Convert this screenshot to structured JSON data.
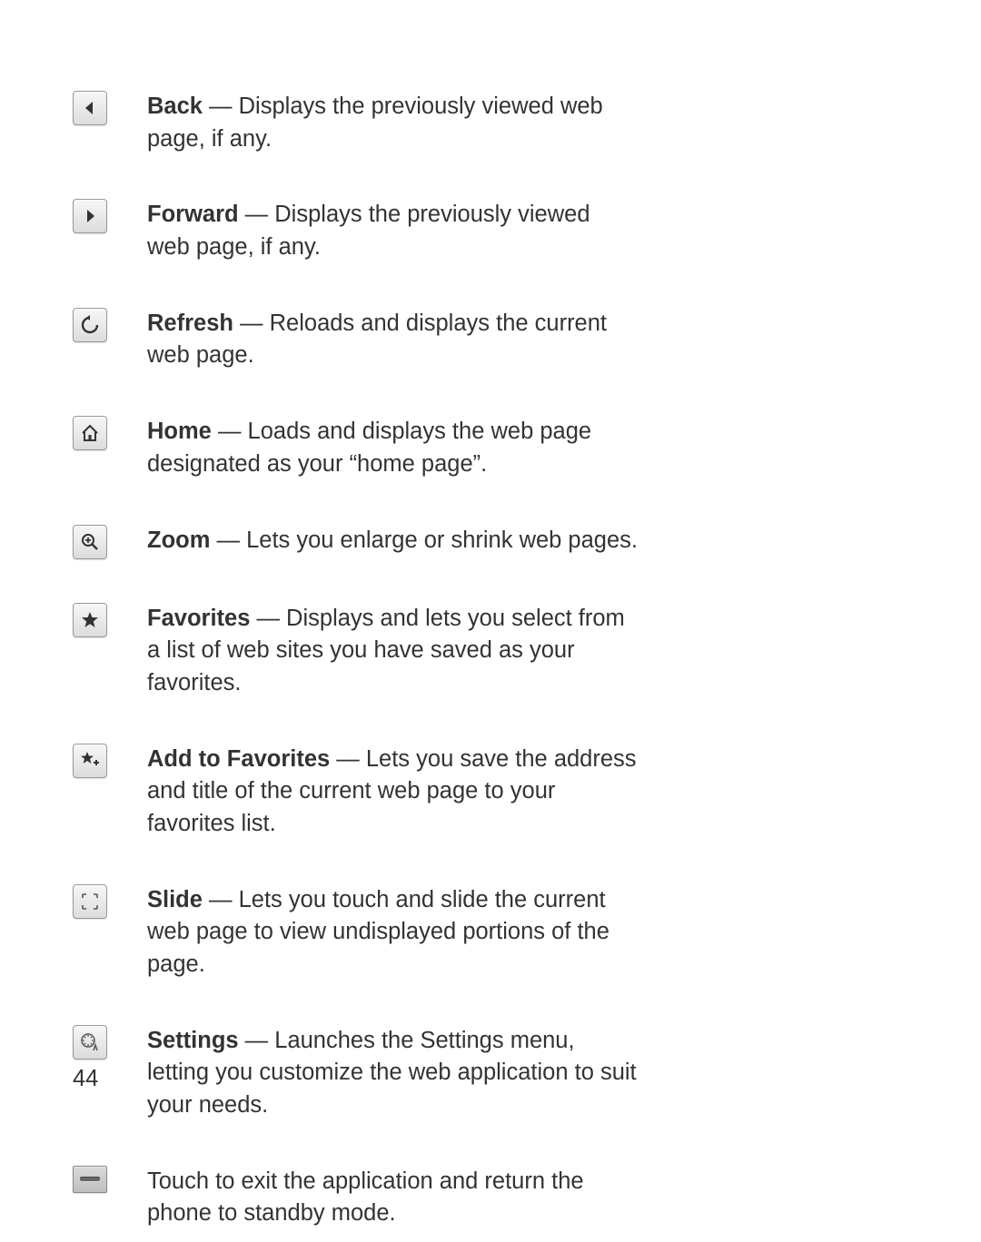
{
  "page_number": "44",
  "items": [
    {
      "icon": "back",
      "title": "Back",
      "desc": " — Displays the previously viewed web page, if any."
    },
    {
      "icon": "forward",
      "title": "Forward",
      "desc": " — Displays the previously viewed web page, if any."
    },
    {
      "icon": "refresh",
      "title": "Refresh",
      "desc": " — Reloads and displays the current web page."
    },
    {
      "icon": "home",
      "title": "Home",
      "desc": " — Loads and displays the web page designated as your “home page”."
    },
    {
      "icon": "zoom",
      "title": "Zoom",
      "desc": " — Lets you enlarge or shrink web pages."
    },
    {
      "icon": "favorites",
      "title": "Favorites",
      "desc": " — Displays and lets you select from a list of web sites you have saved as your favorites."
    },
    {
      "icon": "add-favorites",
      "title": "Add to Favorites",
      "desc": " — Lets you save the address and title of the current web page to your favorites list."
    },
    {
      "icon": "slide",
      "title": "Slide",
      "desc": " — Lets you touch and slide the current web page to view undisplayed portions of the page."
    },
    {
      "icon": "settings",
      "title": "Settings",
      "desc": " — Launches the Settings menu, letting you customize the web application to suit your needs."
    },
    {
      "icon": "exit",
      "title": "",
      "desc": "Touch to exit the application and return the phone to standby mode."
    }
  ]
}
